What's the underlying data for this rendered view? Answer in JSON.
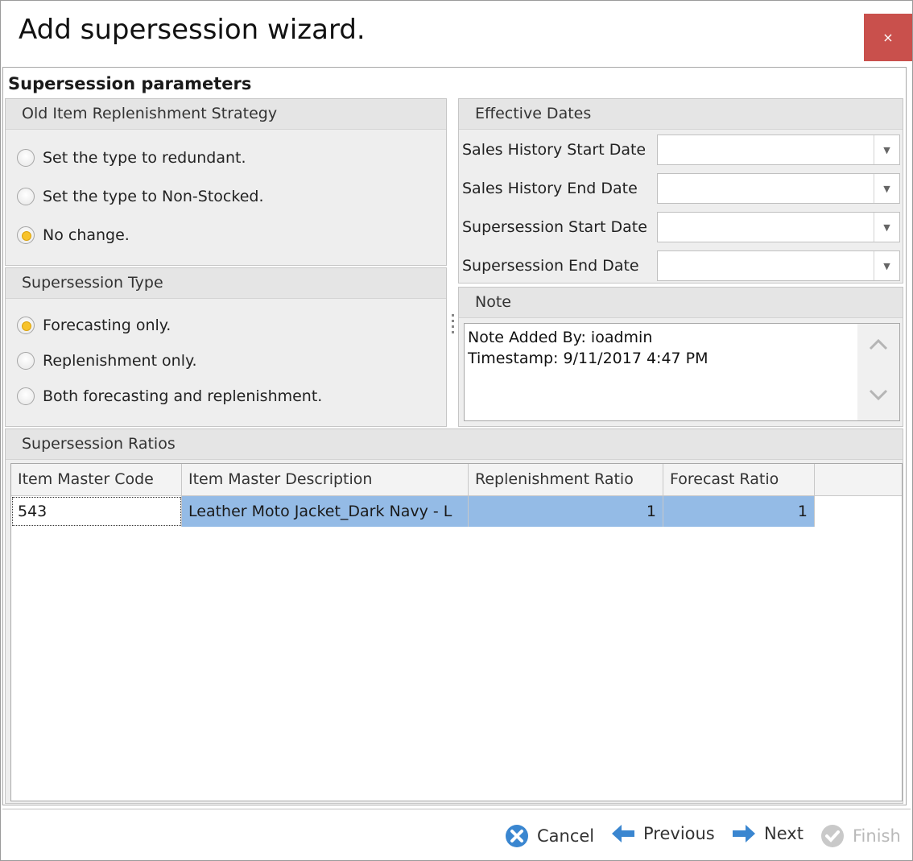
{
  "window": {
    "title": "Add supersession wizard.",
    "close_label": "×",
    "accent_close": "#c9504c"
  },
  "section_title": "Supersession parameters",
  "old_item_group": {
    "title": "Old Item Replenishment Strategy",
    "options": [
      {
        "label": "Set the type to redundant.",
        "checked": false
      },
      {
        "label": "Set the type to Non-Stocked.",
        "checked": false
      },
      {
        "label": "No change.",
        "checked": true
      }
    ]
  },
  "supersession_type_group": {
    "title": "Supersession Type",
    "options": [
      {
        "label": "Forecasting only.",
        "checked": true
      },
      {
        "label": "Replenishment only.",
        "checked": false
      },
      {
        "label": "Both forecasting and replenishment.",
        "checked": false
      }
    ]
  },
  "effective_dates_group": {
    "title": "Effective Dates",
    "fields": [
      {
        "label": "Sales History Start Date",
        "value": ""
      },
      {
        "label": "Sales History End Date",
        "value": ""
      },
      {
        "label": "Supersession Start Date",
        "value": ""
      },
      {
        "label": "Supersession End Date",
        "value": ""
      }
    ]
  },
  "note_group": {
    "title": "Note",
    "text": "Note Added By: ioadmin\nTimestamp: 9/11/2017 4:47 PM"
  },
  "ratios_group": {
    "title": "Supersession Ratios",
    "columns": [
      "Item Master Code",
      "Item Master Description",
      "Replenishment  Ratio",
      "Forecast  Ratio"
    ],
    "rows": [
      {
        "code": "543",
        "description": "Leather Moto Jacket_Dark Navy - L",
        "replenishment_ratio": "1",
        "forecast_ratio": "1"
      }
    ],
    "selection_color": "#94bbe6"
  },
  "footer": {
    "cancel": "Cancel",
    "previous": "Previous",
    "next": "Next",
    "finish": "Finish",
    "icon_color": "#3a86d0"
  }
}
